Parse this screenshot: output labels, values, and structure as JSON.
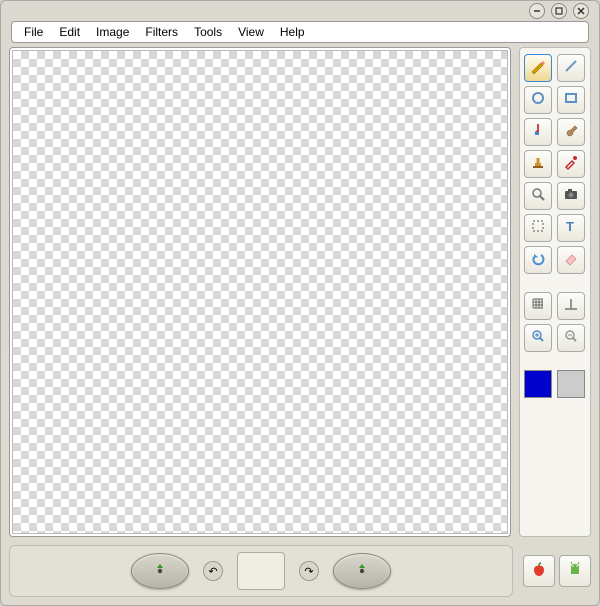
{
  "menu": {
    "file": "File",
    "edit": "Edit",
    "image": "Image",
    "filters": "Filters",
    "tools": "Tools",
    "view": "View",
    "help": "Help"
  },
  "tools": {
    "pencil": "pencil",
    "line": "line",
    "circle": "circle",
    "rect": "rect",
    "fill": "fill",
    "brush": "brush",
    "stamp": "stamp",
    "eyedropper": "eyedropper",
    "magnify": "magnify",
    "camera": "camera",
    "select": "select",
    "text": "text",
    "undo": "undo",
    "eraser": "eraser",
    "grid": "grid",
    "baseline": "baseline",
    "zoomin": "zoomin",
    "zoomout": "zoomout"
  },
  "colors": {
    "primary": "#0000cc",
    "secondary": "#cccccc"
  },
  "bottom": {
    "apple": "apple",
    "android": "android"
  }
}
